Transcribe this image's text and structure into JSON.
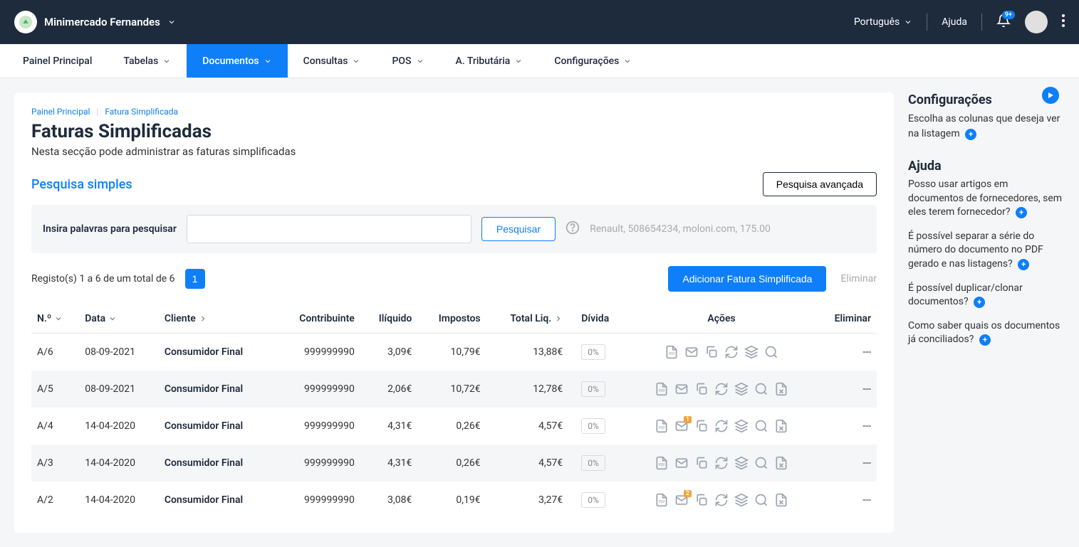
{
  "header": {
    "company_name": "Minimercado Fernandes",
    "language": "Português",
    "help": "Ajuda",
    "notification_badge": "9+"
  },
  "nav": {
    "items": [
      {
        "label": "Painel Principal",
        "dropdown": false
      },
      {
        "label": "Tabelas",
        "dropdown": true
      },
      {
        "label": "Documentos",
        "dropdown": true,
        "active": true
      },
      {
        "label": "Consultas",
        "dropdown": true
      },
      {
        "label": "POS",
        "dropdown": true
      },
      {
        "label": "A. Tributária",
        "dropdown": true
      },
      {
        "label": "Configurações",
        "dropdown": true
      }
    ]
  },
  "breadcrumbs": {
    "home": "Painel Principal",
    "current": "Fatura Simplificada"
  },
  "page": {
    "title": "Faturas Simplificadas",
    "subtitle": "Nesta secção pode administrar as faturas simplificadas"
  },
  "search": {
    "simple_label": "Pesquisa simples",
    "advanced_label": "Pesquisa avançada",
    "prompt": "Insira palavras para pesquisar",
    "button": "Pesquisar",
    "hint": "Renault, 508654234, moloni.com, 175.00"
  },
  "pagination": {
    "records_text": "Registo(s) 1 a 6 de um total de 6",
    "page": "1"
  },
  "actions": {
    "add_label": "Adicionar Fatura Simplificada",
    "eliminar": "Eliminar"
  },
  "table": {
    "headers": {
      "numero": "N.º",
      "data": "Data",
      "cliente": "Cliente",
      "contribuinte": "Contribuinte",
      "iliquido": "Ilíquido",
      "impostos": "Impostos",
      "total_liq": "Total Liq.",
      "divida": "Dívida",
      "acoes": "Ações",
      "eliminar": "Eliminar"
    },
    "rows": [
      {
        "num": "A/6",
        "data": "08-09-2021",
        "cliente": "Consumidor Final",
        "contribuinte": "999999990",
        "iliquido": "3,09€",
        "impostos": "10,79€",
        "total": "13,88€",
        "divida": "0%",
        "has_cancel": false,
        "mail_badge": null
      },
      {
        "num": "A/5",
        "data": "08-09-2021",
        "cliente": "Consumidor Final",
        "contribuinte": "999999990",
        "iliquido": "2,06€",
        "impostos": "10,72€",
        "total": "12,78€",
        "divida": "0%",
        "has_cancel": true,
        "mail_badge": null
      },
      {
        "num": "A/4",
        "data": "14-04-2020",
        "cliente": "Consumidor Final",
        "contribuinte": "999999990",
        "iliquido": "4,31€",
        "impostos": "0,26€",
        "total": "4,57€",
        "divida": "0%",
        "has_cancel": true,
        "mail_badge": "1"
      },
      {
        "num": "A/3",
        "data": "14-04-2020",
        "cliente": "Consumidor Final",
        "contribuinte": "999999990",
        "iliquido": "4,31€",
        "impostos": "0,26€",
        "total": "4,57€",
        "divida": "0%",
        "has_cancel": true,
        "mail_badge": null
      },
      {
        "num": "A/2",
        "data": "14-04-2020",
        "cliente": "Consumidor Final",
        "contribuinte": "999999990",
        "iliquido": "3,08€",
        "impostos": "0,19€",
        "total": "3,27€",
        "divida": "0%",
        "has_cancel": true,
        "mail_badge": "2"
      }
    ]
  },
  "sidebar": {
    "config_title": "Configurações",
    "config_text": "Escolha as colunas que deseja ver na listagem",
    "help_title": "Ajuda",
    "help_links": [
      "Posso usar artigos em documentos de fornecedores, sem eles terem fornecedor?",
      "É possível separar a série do número do documento no PDF gerado e nas listagens?",
      "É possível duplicar/clonar documentos?",
      "Como saber quais os documentos já conciliados?"
    ]
  },
  "delete_placeholder": "---"
}
